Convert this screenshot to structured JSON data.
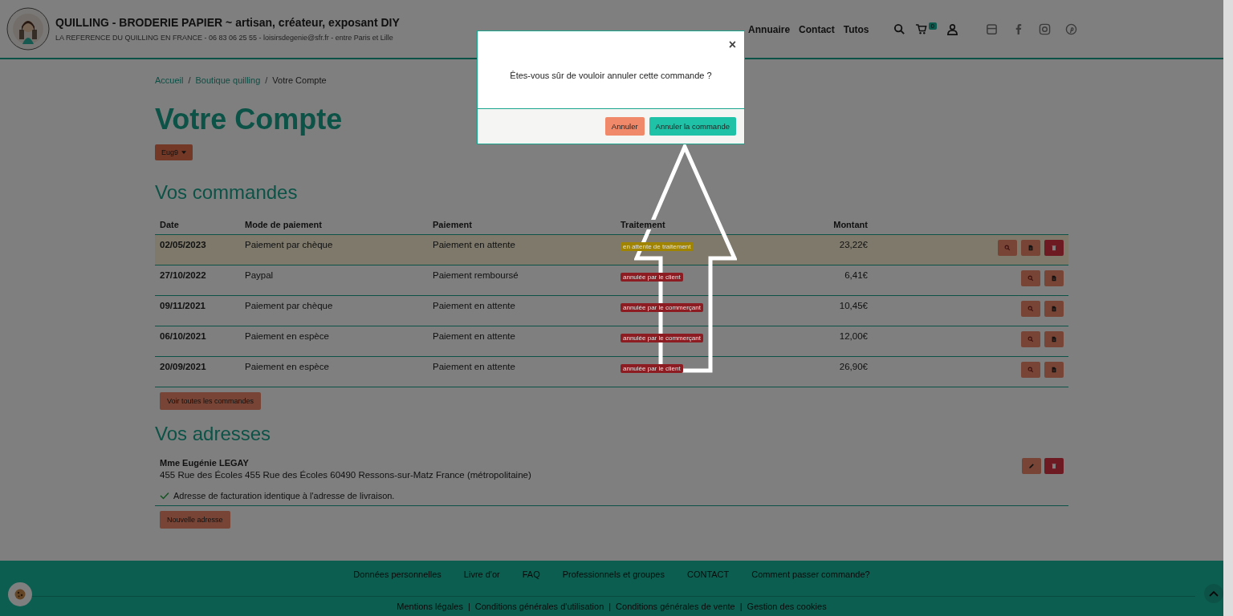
{
  "header": {
    "site_title": "QUILLING - BRODERIE PAPIER ~ artisan, créateur, exposant DIY",
    "tagline": "LA REFERENCE DU QUILLING EN FRANCE - 06 83 06 25 55 - loisirsdegenie@sfr.fr - entre Paris et Lille",
    "nav": [
      "Annuaire",
      "Contact",
      "Tutos"
    ],
    "cart_count": "0"
  },
  "breadcrumb_separator": "/",
  "breadcrumb": [
    {
      "label": "Accueil",
      "current": false
    },
    {
      "label": "Boutique quilling",
      "current": false
    },
    {
      "label": "Votre Compte",
      "current": true
    }
  ],
  "page_title": "Votre Compte",
  "account_menu": "Eug9",
  "orders": {
    "heading": "Vos commandes",
    "columns": [
      "Date",
      "Mode de paiement",
      "Paiement",
      "Traitement",
      "Montant"
    ],
    "rows": [
      {
        "date": "02/05/2023",
        "method": "Paiement par chèque",
        "payment": "Paiement en attente",
        "status": "en attente de traitement",
        "color": "#a08400",
        "amount": "23,22€",
        "highlighted": true,
        "can_delete": true
      },
      {
        "date": "27/10/2022",
        "method": "Paypal",
        "payment": "Paiement remboursé",
        "status": "annulée par le client",
        "color": "#8c1c22",
        "amount": "6,41€",
        "highlighted": false,
        "can_delete": false
      },
      {
        "date": "09/11/2021",
        "method": "Paiement par chèque",
        "payment": "Paiement en attente",
        "status": "annulée par le commerçant",
        "color": "#8c1c22",
        "amount": "10,45€",
        "highlighted": false,
        "can_delete": false
      },
      {
        "date": "06/10/2021",
        "method": "Paiement en espèce",
        "payment": "Paiement en attente",
        "status": "annulée par le commerçant",
        "color": "#8c1c22",
        "amount": "12,00€",
        "highlighted": false,
        "can_delete": false
      },
      {
        "date": "20/09/2021",
        "method": "Paiement en espèce",
        "payment": "Paiement en attente",
        "status": "annulée par le client",
        "color": "#8c1c22",
        "amount": "26,90€",
        "highlighted": false,
        "can_delete": false
      }
    ],
    "view_all": "Voir toutes les commandes"
  },
  "addresses": {
    "heading": "Vos adresses",
    "name": "Mme Eugénie LEGAY",
    "line": "455 Rue des Écoles 455 Rue des Écoles 60490 Ressons-sur-Matz France (métropolitaine)",
    "billing_same": true,
    "billing_note": "Adresse de facturation identique à l'adresse de livraison.",
    "new_button": "Nouvelle adresse"
  },
  "footer": {
    "links": [
      "Données personnelles",
      "Livre d'or",
      "FAQ",
      "Professionnels et groupes",
      "CONTACT",
      "Comment passer commande?"
    ],
    "legal_separator": "|",
    "legal": [
      "Mentions légales",
      "Conditions générales d'utilisation",
      "Conditions générales de vente",
      "Gestion des cookies"
    ]
  },
  "modal": {
    "close": "×",
    "message": "Êtes-vous sûr de vouloir annuler cette commande ?",
    "cancel": "Annuler",
    "confirm": "Annuler la commande"
  }
}
